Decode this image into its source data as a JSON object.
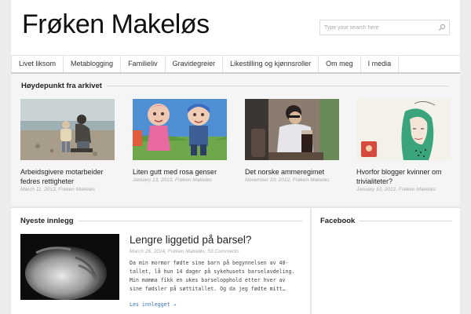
{
  "site": {
    "title": "Frøken Makeløs"
  },
  "search": {
    "placeholder": "Type your search here",
    "icon": "search-icon"
  },
  "nav": {
    "items": [
      {
        "label": "Livet liksom"
      },
      {
        "label": "Metablogging"
      },
      {
        "label": "Familieliv"
      },
      {
        "label": "Gravidegreier"
      },
      {
        "label": "Likestilling og kjønnsroller"
      },
      {
        "label": "Om meg"
      },
      {
        "label": "I media"
      }
    ]
  },
  "highlights": {
    "title": "Høydepunkt fra arkivet",
    "cards": [
      {
        "title": "Arbeidsgivere motarbeider fedres rettigheter",
        "meta": "March 11, 2013, Frøken Makeløs"
      },
      {
        "title": "Liten gutt med rosa genser",
        "meta": "January 13, 2013, Frøken Makeløs"
      },
      {
        "title": "Det norske ammeregimet",
        "meta": "November 20, 2012, Frøken Makeløs"
      },
      {
        "title": "Hvorfor blogger kvinner om trivialiteter?",
        "meta": "January 10, 2012, Frøken Makeløs"
      }
    ]
  },
  "latest": {
    "title": "Nyeste innlegg",
    "post": {
      "title": "Lengre liggetid på barsel?",
      "meta": "March 26, 2014, Frøken Makeløs, 53 Comments",
      "excerpt": "Da min mormor fødte sine barn på begynnelsen av 40-tallet, lå hun 14 dager på sykehusets barselavdeling. Min mamma fikk en ukes barselopphold etter hver av sine fødsler på søttitallet. Og da jeg fødte mitt…",
      "read_more": "Les innlegget →"
    }
  },
  "facebook": {
    "title": "Facebook"
  },
  "colors": {
    "link": "#3a70b8",
    "page_bg": "#ececec",
    "meta": "#aaaaaa"
  }
}
